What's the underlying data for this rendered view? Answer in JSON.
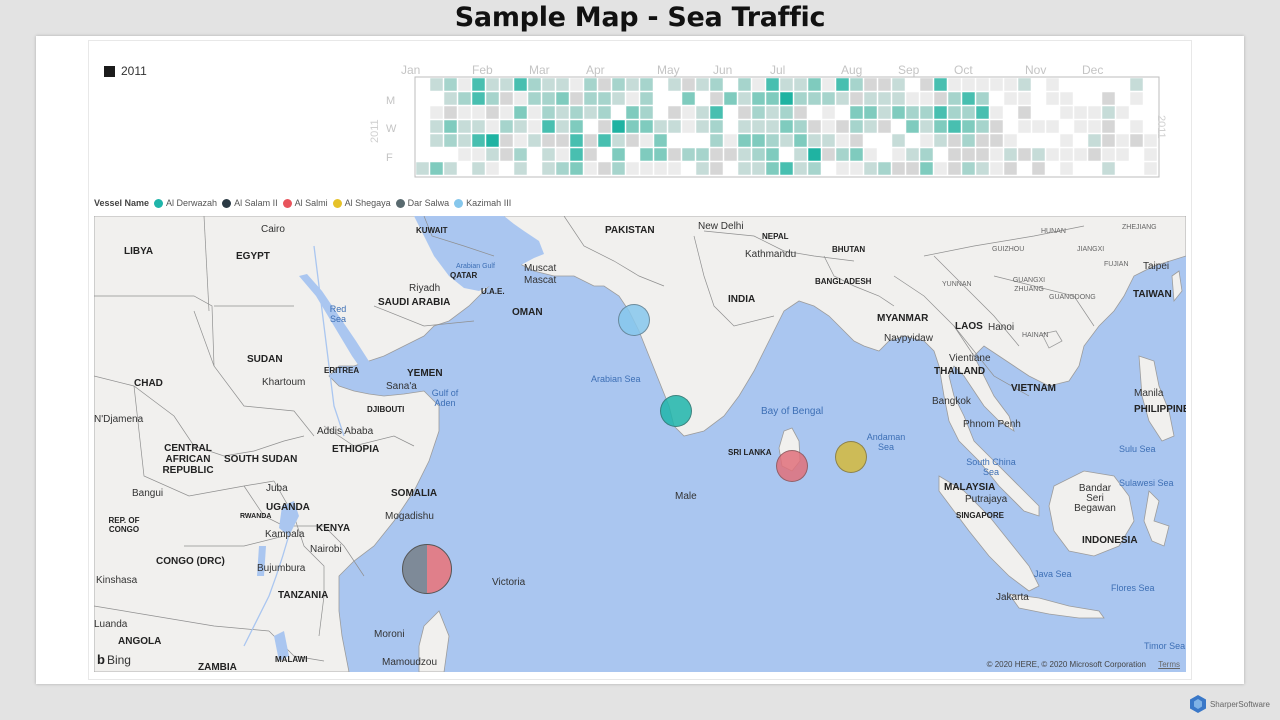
{
  "title": "Sample Map - Sea Traffic",
  "calendar": {
    "legend_year": "2011",
    "months": [
      "Jan",
      "Feb",
      "Mar",
      "Apr",
      "May",
      "Jun",
      "Jul",
      "Aug",
      "Sep",
      "Oct",
      "Nov",
      "Dec"
    ],
    "day_labels": [
      "M",
      "W",
      "F"
    ],
    "side_year": "2011",
    "scale_colors": [
      "#ffffff",
      "#ececec",
      "#d6d6d6",
      "#c6dcd8",
      "#a6d4cc",
      "#7fcbbe",
      "#48bfb0",
      "#1fb3a2"
    ]
  },
  "vessel_legend": {
    "title": "Vessel Name",
    "items": [
      {
        "name": "Al Derwazah",
        "color": "#1fb5aa"
      },
      {
        "name": "Al Salam II",
        "color": "#2b3a44"
      },
      {
        "name": "Al Salmi",
        "color": "#e8545c"
      },
      {
        "name": "Al Shegaya",
        "color": "#e6c229"
      },
      {
        "name": "Dar Salwa",
        "color": "#596a6f"
      },
      {
        "name": "Kazimah III",
        "color": "#86c7ec"
      }
    ]
  },
  "map": {
    "bubbles": [
      {
        "vessel": "Kazimah III",
        "color": "#86c7ec"
      },
      {
        "vessel": "Al Derwazah",
        "color": "#1fb5aa"
      },
      {
        "vessel": "Al Salmi",
        "color": "#e0707a"
      },
      {
        "vessel": "Al Shegaya",
        "color": "#d4b93c"
      },
      {
        "vessel": "Dar Salwa / Al Salmi",
        "colors": [
          "#7e8a98",
          "#e07f8a"
        ]
      }
    ],
    "countries": [
      "LIBYA",
      "EGYPT",
      "KUWAIT",
      "PAKISTAN",
      "NEPAL",
      "BHUTAN",
      "QATAR",
      "U.A.E.",
      "SAUDI ARABIA",
      "OMAN",
      "INDIA",
      "BANGLADESH",
      "MYANMAR",
      "LAOS",
      "TAIWAN",
      "SUDAN",
      "CHAD",
      "ERITREA",
      "YEMEN",
      "DJIBOUTI",
      "ETHIOPIA",
      "THAILAND",
      "VIETNAM",
      "PHILIPPINES",
      "CENTRAL AFRICAN REPUBLIC",
      "SOUTH SUDAN",
      "SRI LANKA",
      "SOMALIA",
      "UGANDA",
      "KENYA",
      "MALAYSIA",
      "SINGAPORE",
      "REP. OF CONGO",
      "RWANDA",
      "CONGO (DRC)",
      "TANZANIA",
      "INDONESIA",
      "ANGOLA",
      "MALAWI",
      "ZAMBIA"
    ],
    "cities": [
      "Cairo",
      "New Delhi",
      "Kathmandu",
      "Muscat",
      "Mascat",
      "Riyadh",
      "Khartoum",
      "Sana'a",
      "Addis Ababa",
      "Naypyidaw",
      "Hanoi",
      "Vientiane",
      "Bangkok",
      "Phnom Penh",
      "Manila",
      "Taipei",
      "Juba",
      "Bangui",
      "Kampala",
      "Nairobi",
      "Mogadishu",
      "Bujumbura",
      "Kinshasa",
      "Male",
      "Victoria",
      "Moroni",
      "Mamoudzou",
      "Putrajaya",
      "Bandar Seri Begawan",
      "Jakarta",
      "N'Djamena",
      "Luanda"
    ],
    "seas": [
      "Arabian Gulf",
      "Red Sea",
      "Gulf of Aden",
      "Arabian Sea",
      "Bay of Bengal",
      "Andaman Sea",
      "South China Sea",
      "Sulu Sea",
      "Sulawesi Sea",
      "Java Sea",
      "Flores Sea",
      "Timor Sea"
    ],
    "regions": [
      "HUNAN",
      "ZHEJIANG",
      "GUIZHOU",
      "JIANGXI",
      "FUJIAN",
      "YUNNAN",
      "GUANGXI ZHUANG",
      "GUANGDONG",
      "HAINAN"
    ],
    "attribution": "© 2020 HERE, © 2020 Microsoft Corporation",
    "terms": "Terms",
    "bing": "Bing"
  },
  "brand": {
    "name": "SharperSoftware"
  }
}
